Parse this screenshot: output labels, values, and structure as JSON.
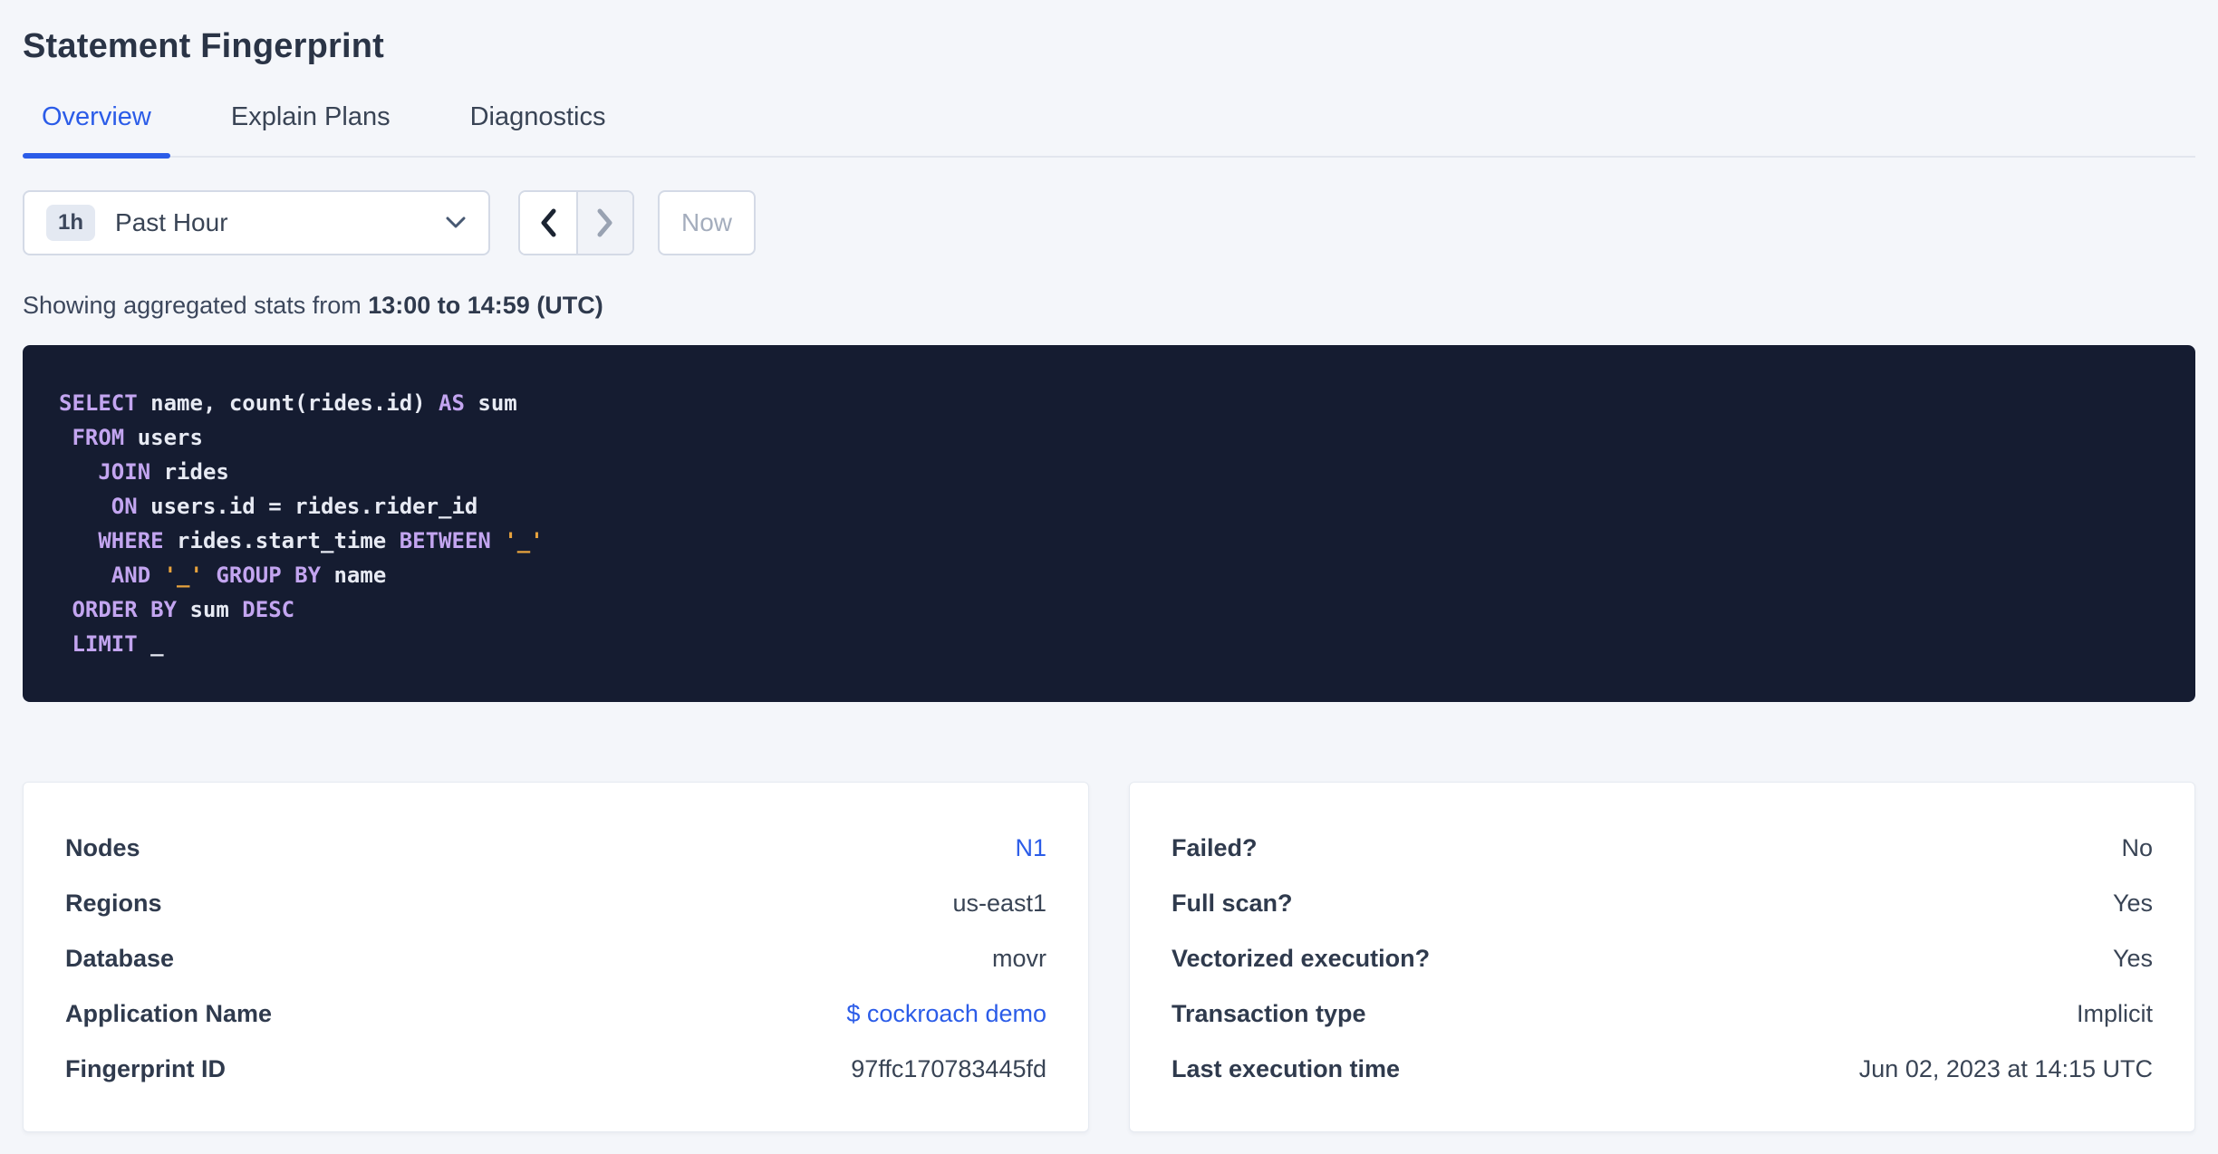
{
  "page": {
    "title": "Statement Fingerprint"
  },
  "tabs": [
    {
      "label": "Overview",
      "active": true
    },
    {
      "label": "Explain Plans",
      "active": false
    },
    {
      "label": "Diagnostics",
      "active": false
    }
  ],
  "time_picker": {
    "badge": "1h",
    "label": "Past Hour",
    "now_label": "Now",
    "icons": {
      "dropdown": "chevron-down",
      "prev": "chevron-left",
      "next": "chevron-right"
    },
    "prev_enabled": true,
    "next_enabled": false
  },
  "stats_line": {
    "prefix": "Showing aggregated stats from ",
    "range": "13:00 to 14:59 (UTC)"
  },
  "sql": {
    "lines": [
      [
        {
          "t": "SELECT",
          "c": "kw"
        },
        {
          "t": " name, count(rides.id) ",
          "c": "pl"
        },
        {
          "t": "AS",
          "c": "kw"
        },
        {
          "t": " sum",
          "c": "pl"
        }
      ],
      [
        {
          "t": " ",
          "c": "pl"
        },
        {
          "t": "FROM",
          "c": "kw"
        },
        {
          "t": " users",
          "c": "pl"
        }
      ],
      [
        {
          "t": "   ",
          "c": "pl"
        },
        {
          "t": "JOIN",
          "c": "kw"
        },
        {
          "t": " rides",
          "c": "pl"
        }
      ],
      [
        {
          "t": "    ",
          "c": "pl"
        },
        {
          "t": "ON",
          "c": "kw"
        },
        {
          "t": " users.id = rides.rider_id",
          "c": "pl"
        }
      ],
      [
        {
          "t": "   ",
          "c": "pl"
        },
        {
          "t": "WHERE",
          "c": "kw"
        },
        {
          "t": " rides.start_time ",
          "c": "pl"
        },
        {
          "t": "BETWEEN",
          "c": "kw"
        },
        {
          "t": " ",
          "c": "pl"
        },
        {
          "t": "'_'",
          "c": "str"
        }
      ],
      [
        {
          "t": "    ",
          "c": "pl"
        },
        {
          "t": "AND",
          "c": "kw"
        },
        {
          "t": " ",
          "c": "pl"
        },
        {
          "t": "'_'",
          "c": "str"
        },
        {
          "t": " ",
          "c": "pl"
        },
        {
          "t": "GROUP BY",
          "c": "kw"
        },
        {
          "t": " name",
          "c": "pl"
        }
      ],
      [
        {
          "t": " ",
          "c": "pl"
        },
        {
          "t": "ORDER BY",
          "c": "kw"
        },
        {
          "t": " sum ",
          "c": "pl"
        },
        {
          "t": "DESC",
          "c": "kw"
        }
      ],
      [
        {
          "t": " ",
          "c": "pl"
        },
        {
          "t": "LIMIT",
          "c": "kw"
        },
        {
          "t": " _",
          "c": "pl"
        }
      ]
    ]
  },
  "cards": {
    "left": {
      "rows": [
        {
          "label": "Nodes",
          "value": "N1",
          "link": true
        },
        {
          "label": "Regions",
          "value": "us-east1",
          "link": false
        },
        {
          "label": "Database",
          "value": "movr",
          "link": false
        },
        {
          "label": "Application Name",
          "value": "$ cockroach demo",
          "link": true
        },
        {
          "label": "Fingerprint ID",
          "value": "97ffc170783445fd",
          "link": false
        }
      ]
    },
    "right": {
      "rows": [
        {
          "label": "Failed?",
          "value": "No",
          "link": false
        },
        {
          "label": "Full scan?",
          "value": "Yes",
          "link": false
        },
        {
          "label": "Vectorized execution?",
          "value": "Yes",
          "link": false
        },
        {
          "label": "Transaction type",
          "value": "Implicit",
          "link": false
        },
        {
          "label": "Last execution time",
          "value": "Jun 02, 2023 at 14:15 UTC",
          "link": false
        }
      ]
    }
  },
  "colors": {
    "accent_blue": "#2b5ce8",
    "page_background": "#f4f6fa",
    "sql_background": "#151c31",
    "sql_keyword": "#c3a5f0",
    "sql_string": "#e8a33d",
    "sql_plain": "#e7eaf3",
    "text_dark": "#2f3a4d",
    "disabled_text": "#a4adbd"
  }
}
